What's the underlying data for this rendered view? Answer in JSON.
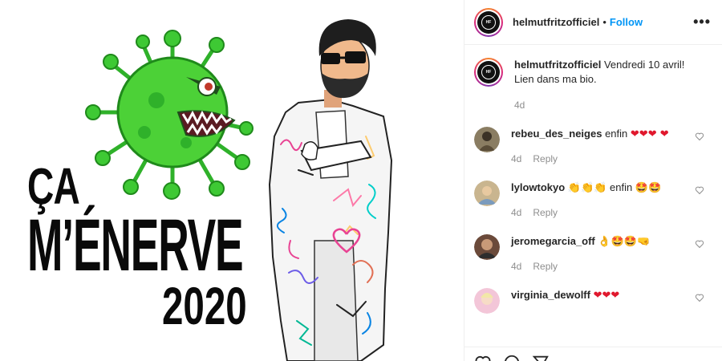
{
  "post": {
    "headline": [
      "ÇA",
      "M’ÉNERVE",
      "2020"
    ]
  },
  "header": {
    "username": "helmutfritzofficiel",
    "separator": "•",
    "follow_label": "Follow",
    "more_label": "•••"
  },
  "caption": {
    "username": "helmutfritzofficiel",
    "text": "Vendredi 10 avril! Lien dans ma bio.",
    "age": "4d"
  },
  "comments": [
    {
      "username": "rebeu_des_neiges",
      "text": "enfin",
      "emoji": "❤❤❤ ❤",
      "age": "4d",
      "reply_label": "Reply"
    },
    {
      "username": "lylowtokyo",
      "text_before": "👏👏👏",
      "text": "enfin",
      "emoji": "🤩🤩",
      "age": "4d",
      "reply_label": "Reply"
    },
    {
      "username": "jeromegarcia_off",
      "emoji": "👌🤩🤩🤜",
      "age": "4d",
      "reply_label": "Reply"
    },
    {
      "username": "virginia_dewolff",
      "emoji": "❤❤❤"
    }
  ],
  "colors": {
    "accent": "#0095f6",
    "virus_green": "#4cd137",
    "heart_red": "#e0182d"
  }
}
